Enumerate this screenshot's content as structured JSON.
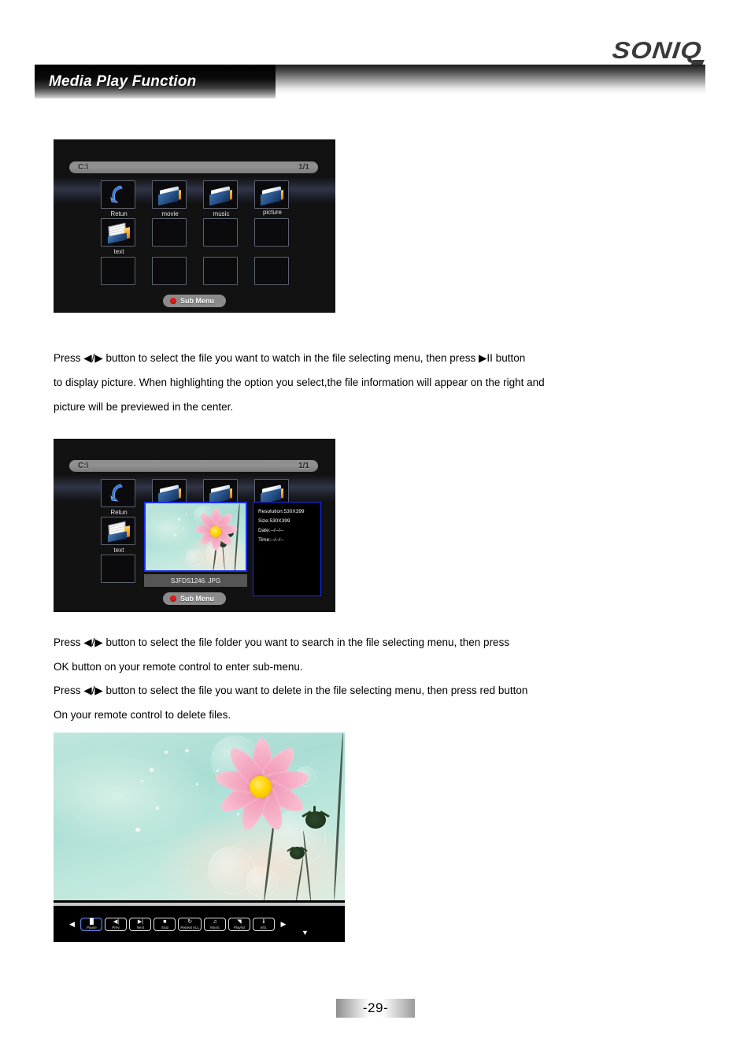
{
  "header": {
    "brand": "SONIQ",
    "section_title": "Media Play Function"
  },
  "screenshot_one": {
    "path": "C:\\",
    "page_indicator": "1/1",
    "tiles": [
      {
        "label": "Retun",
        "icon": "return-arrow-icon"
      },
      {
        "label": "movie",
        "icon": "folder-icon"
      },
      {
        "label": "music",
        "icon": "folder-icon"
      },
      {
        "label": "picture",
        "icon": "folder-icon"
      },
      {
        "label": "text",
        "icon": "text-folder-icon"
      }
    ],
    "sub_menu_label": "Sub Menu"
  },
  "paragraph_one": [
    "Press ◀/▶ button to select the file you want to watch in the file selecting menu, then press ▶II button",
    "to display picture. When highlighting the option you select,the file information will appear on the right and",
    "picture will be previewed in the center."
  ],
  "screenshot_two": {
    "path": "C:\\",
    "page_indicator": "1/1",
    "tiles": [
      {
        "label": "Retun",
        "icon": "return-arrow-icon"
      },
      {
        "label": "",
        "icon": "folder-icon"
      },
      {
        "label": "",
        "icon": "folder-icon"
      },
      {
        "label": "",
        "icon": "folder-icon"
      },
      {
        "label": "text",
        "icon": "text-folder-icon"
      }
    ],
    "filename": "SJFDS1246. JPG",
    "info_panel": {
      "resolution": "Resolution:530X399",
      "size": "Size:530X399",
      "date": "Date:--/--/--",
      "time": "Time:--/--/--"
    },
    "sub_menu_label": "Sub Menu"
  },
  "paragraph_two": [
    "Press ◀/▶ button to select the file folder you want to search in the file selecting menu, then press",
    "OK button on your remote control  to enter sub-menu.",
    "Press ◀/▶ button to select the file you want to delete in the file selecting  menu, then press red button",
    "On your remote control  to  delete  files."
  ],
  "screenshot_three": {
    "prev_arrow": "◀",
    "next_arrow": "▶",
    "down_arrow": "▼",
    "controls": [
      {
        "label": "Pause",
        "glyph": "▐▌",
        "name": "pause-button",
        "active": true
      },
      {
        "label": "Prev.",
        "glyph": "◀|",
        "name": "previous-button",
        "active": false
      },
      {
        "label": "Next",
        "glyph": "▶|",
        "name": "next-button",
        "active": false
      },
      {
        "label": "Stop",
        "glyph": "■",
        "name": "stop-button",
        "active": false
      },
      {
        "label": "Repeat ALL",
        "glyph": "↻",
        "name": "repeat-button",
        "active": false
      },
      {
        "label": "Music",
        "glyph": "♫",
        "name": "music-button",
        "active": false
      },
      {
        "label": "Playlist",
        "glyph": "◥",
        "name": "playlist-button",
        "active": false
      },
      {
        "label": "Info.",
        "glyph": "ℹ",
        "name": "info-button",
        "active": false
      }
    ]
  },
  "footer": {
    "page_number": "-29-"
  },
  "colors": {
    "accent_red": "#e01b1b",
    "panel_border_blue": "#1a2df0",
    "osd_background": "#121212",
    "path_bar": "#8d8d8d"
  }
}
